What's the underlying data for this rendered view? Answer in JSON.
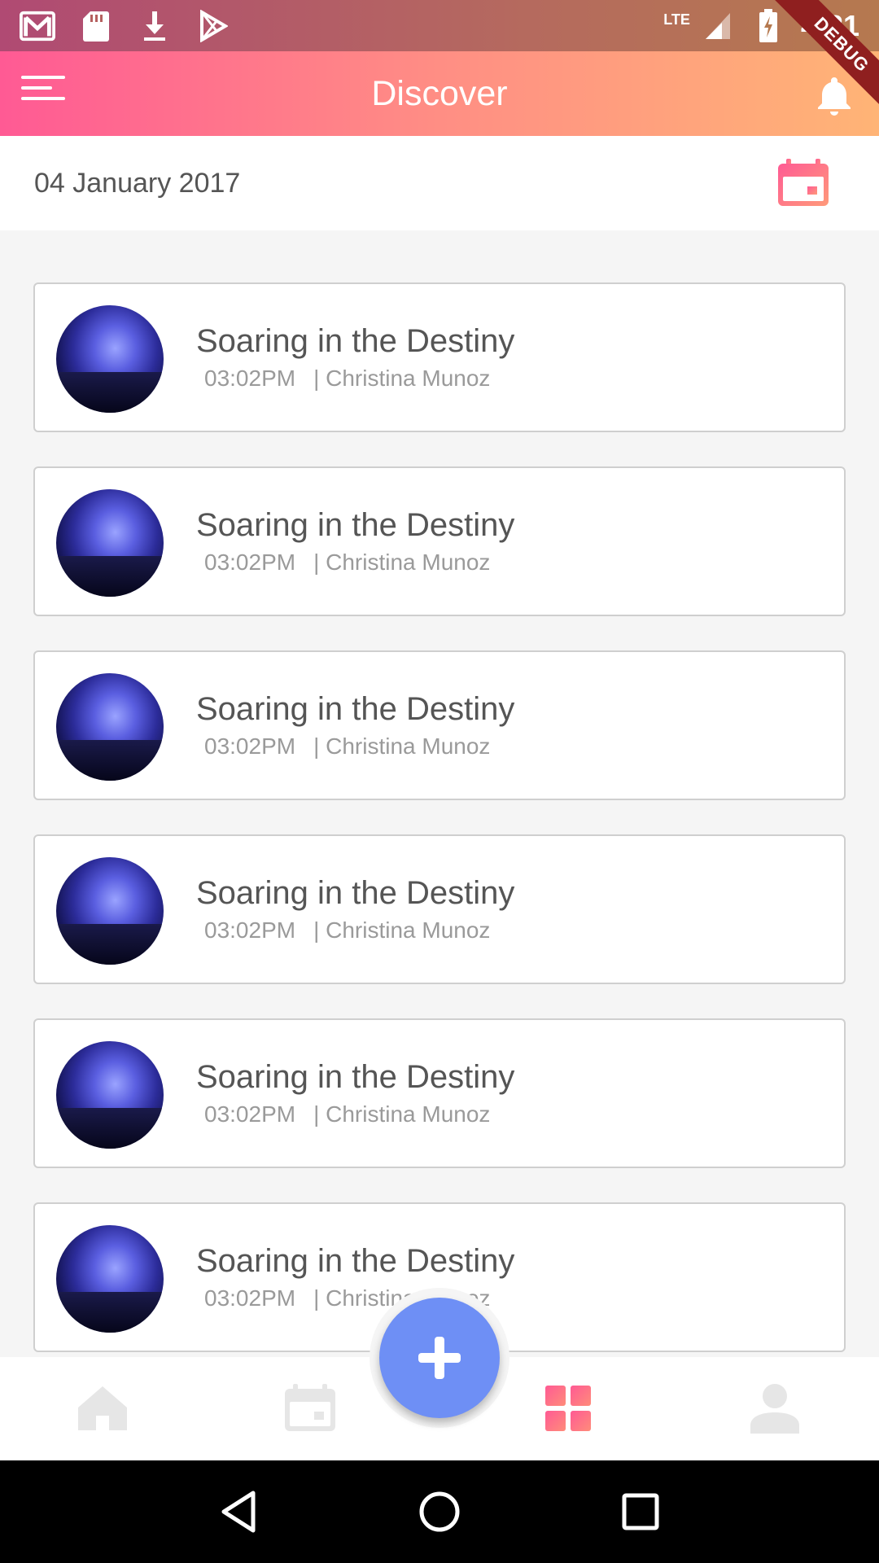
{
  "status_bar": {
    "time": "4:21",
    "network": "LTE",
    "icons": [
      "gmail-icon",
      "sd-card-icon",
      "download-icon",
      "play-store-icon",
      "signal-icon",
      "battery-icon"
    ]
  },
  "debug_banner": "DEBUG",
  "app_bar": {
    "title": "Discover",
    "menu_icon": "menu-icon",
    "notification_icon": "bell-icon"
  },
  "date_header": {
    "date": "04 January 2017",
    "calendar_icon": "calendar-icon"
  },
  "items": [
    {
      "title": "Soaring in the Destiny",
      "time": "03:02PM",
      "author": "| Christina Munoz"
    },
    {
      "title": "Soaring in the Destiny",
      "time": "03:02PM",
      "author": "| Christina Munoz"
    },
    {
      "title": "Soaring in the Destiny",
      "time": "03:02PM",
      "author": "| Christina Munoz"
    },
    {
      "title": "Soaring in the Destiny",
      "time": "03:02PM",
      "author": "| Christina Munoz"
    },
    {
      "title": "Soaring in the Destiny",
      "time": "03:02PM",
      "author": "| Christina Munoz"
    },
    {
      "title": "Soaring in the Destiny",
      "time": "03:02PM",
      "author": "| Christina Munoz"
    }
  ],
  "bottom_nav": {
    "items": [
      "home-icon",
      "calendar-icon",
      "grid-icon",
      "profile-icon"
    ],
    "active": "grid-icon",
    "fab_icon": "plus-icon"
  },
  "colors": {
    "app_bar_start": "#ff5a94",
    "app_bar_end": "#ffb476",
    "accent": "#f7577f",
    "fab": "#6e8ff5",
    "inactive_icon": "#e6e6e6"
  }
}
